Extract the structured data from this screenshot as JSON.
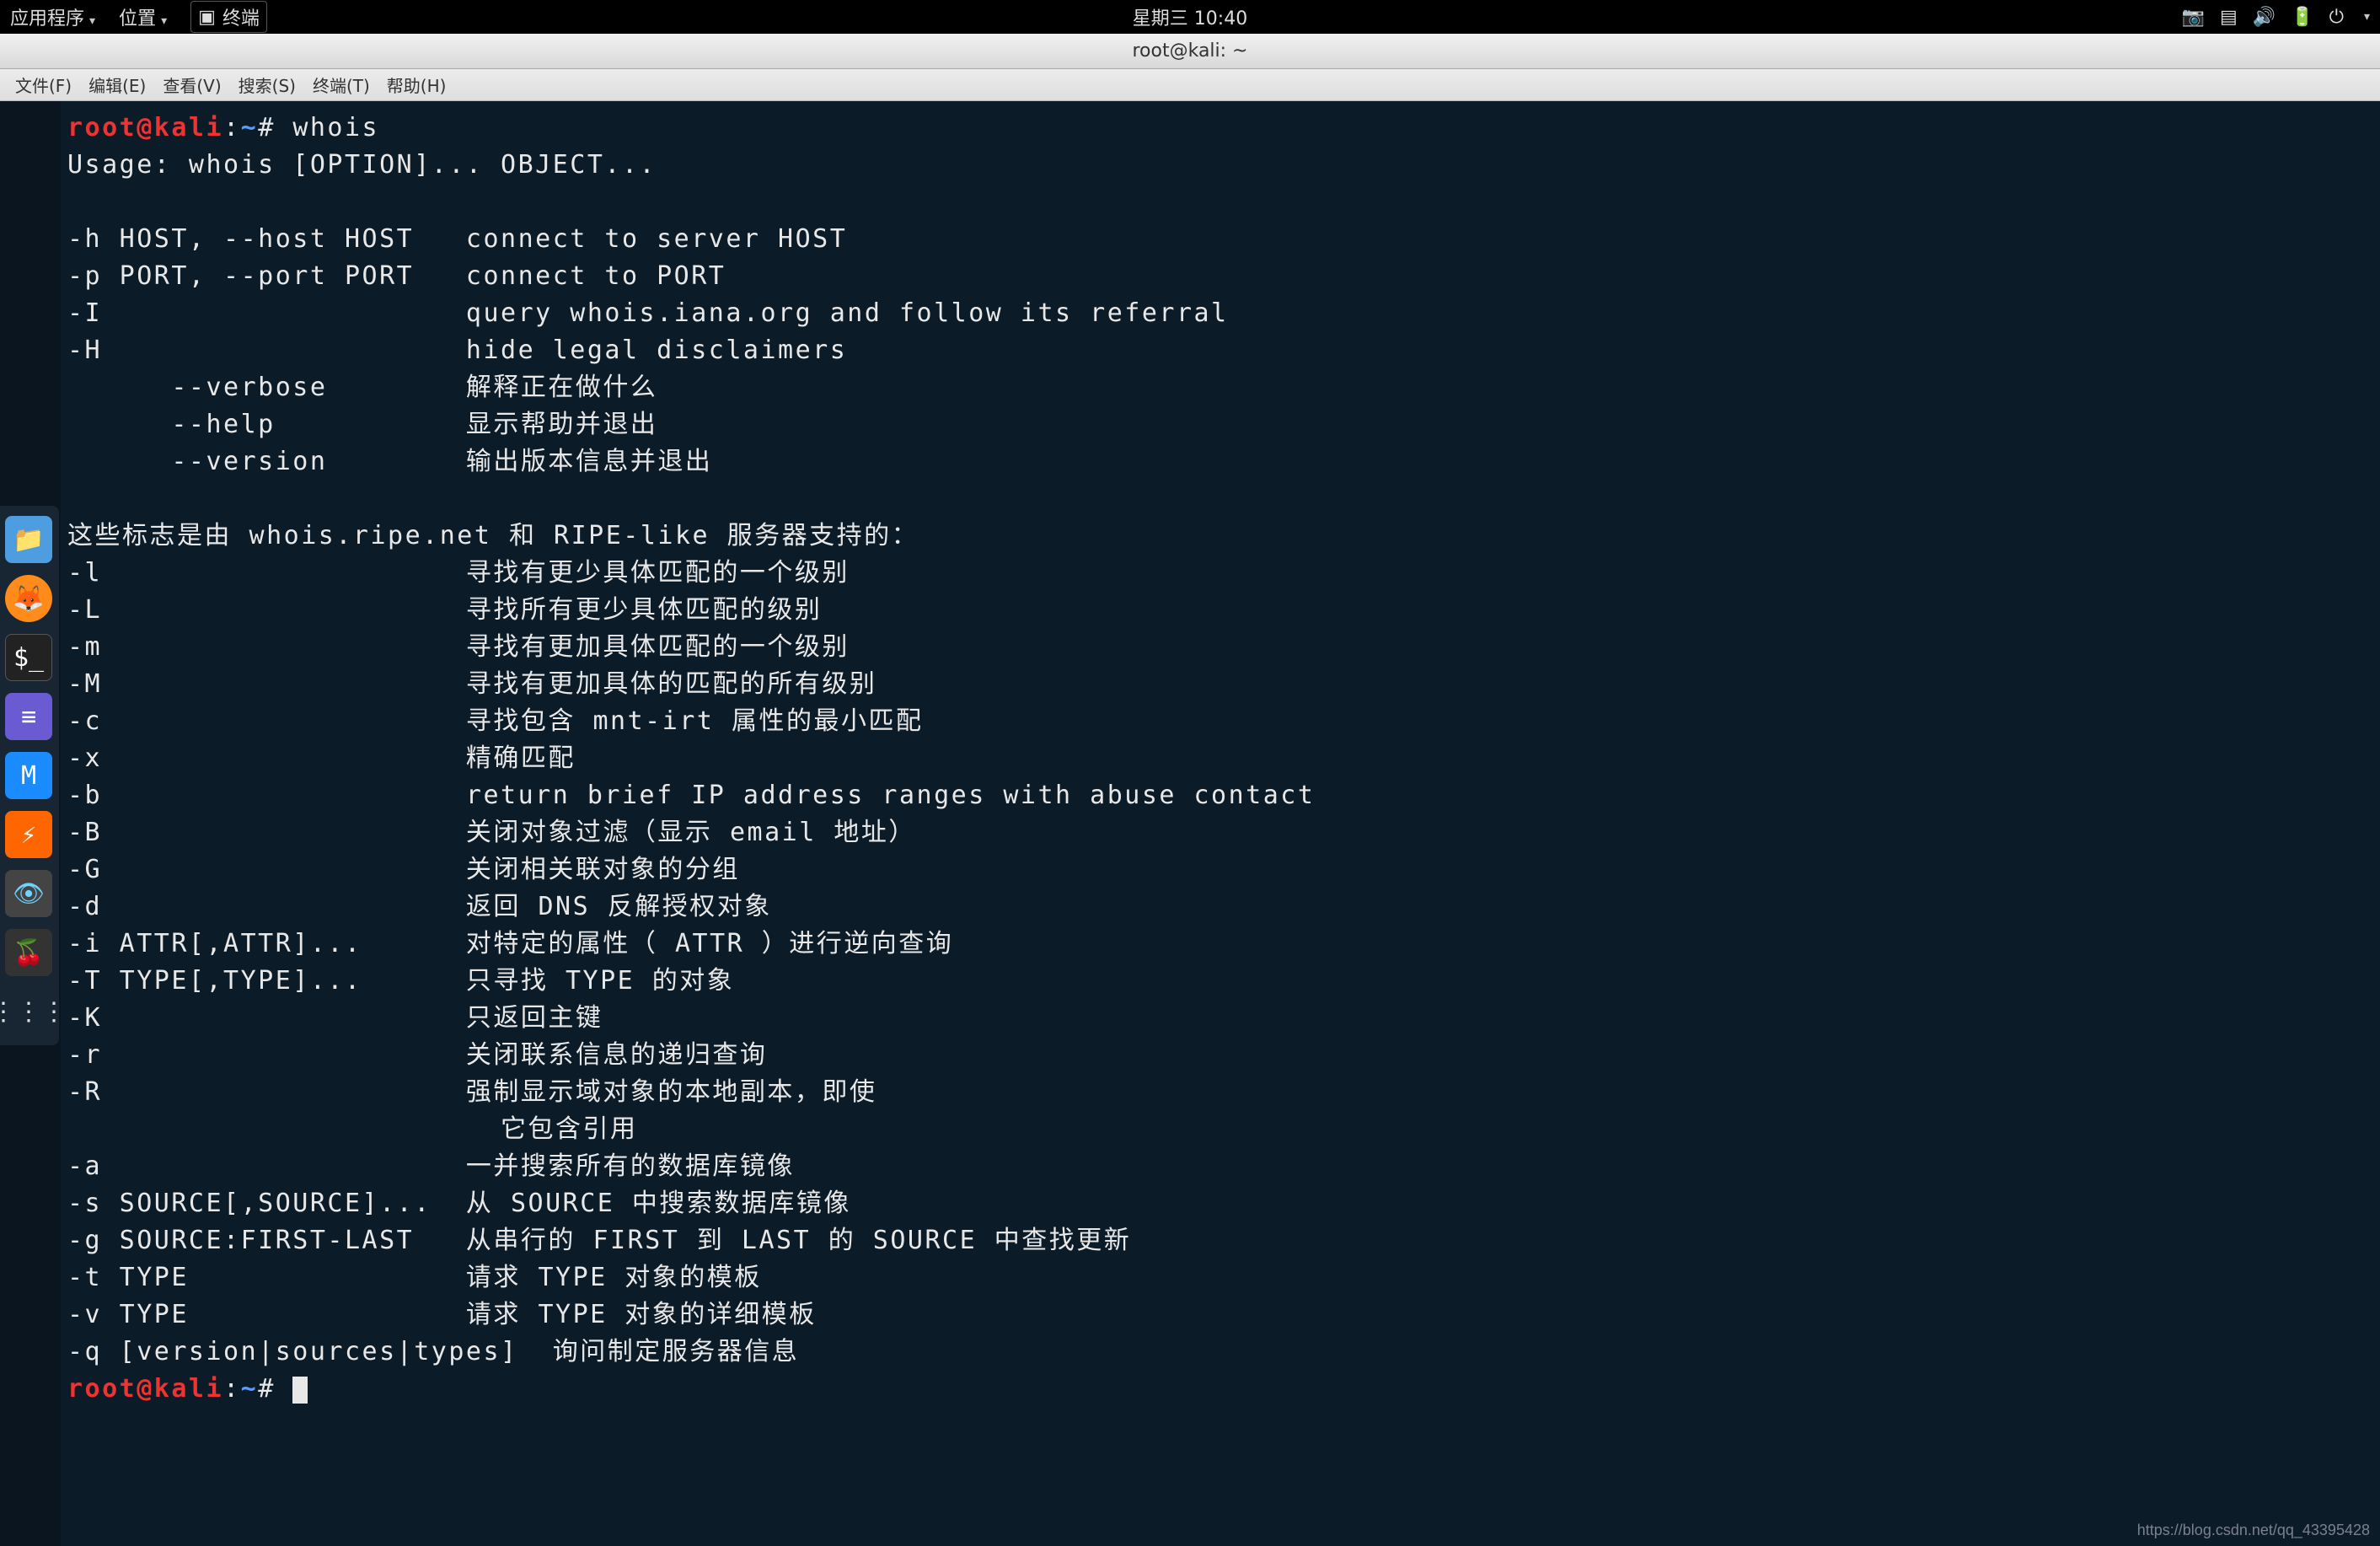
{
  "top_panel": {
    "apps": "应用程序",
    "places": "位置",
    "terminal_btn": "终端",
    "clock": "星期三 10:40"
  },
  "window": {
    "title": "root@kali: ~"
  },
  "menu": {
    "file": "文件(F)",
    "edit": "编辑(E)",
    "view": "查看(V)",
    "search": "搜索(S)",
    "terminal": "终端(T)",
    "help": "帮助(H)"
  },
  "dock": {
    "files": "files-app",
    "firefox": "firefox-app",
    "terminal": "terminal-app",
    "texteditor": "text-editor-app",
    "metasploit": "metasploit-app",
    "zenmap": "zenmap-app",
    "eye": "eye-app",
    "cherry": "cherrytree-app",
    "grid": "show-apps"
  },
  "prompt": {
    "user": "root@kali",
    "path": "~",
    "symbol": "#"
  },
  "command": "whois",
  "output": [
    "Usage: whois [OPTION]... OBJECT...",
    "",
    "-h HOST, --host HOST   connect to server HOST",
    "-p PORT, --port PORT   connect to PORT",
    "-I                     query whois.iana.org and follow its referral",
    "-H                     hide legal disclaimers",
    "      --verbose        解释正在做什么",
    "      --help           显示帮助并退出",
    "      --version        输出版本信息并退出",
    "",
    "这些标志是由 whois.ripe.net 和 RIPE-like 服务器支持的：",
    "-l                     寻找有更少具体匹配的一个级别",
    "-L                     寻找所有更少具体匹配的级别",
    "-m                     寻找有更加具体匹配的一个级别",
    "-M                     寻找有更加具体的匹配的所有级别",
    "-c                     寻找包含 mnt-irt 属性的最小匹配",
    "-x                     精确匹配",
    "-b                     return brief IP address ranges with abuse contact",
    "-B                     关闭对象过滤（显示 email 地址）",
    "-G                     关闭相关联对象的分组",
    "-d                     返回 DNS 反解授权对象",
    "-i ATTR[,ATTR]...      对特定的属性（ ATTR ）进行逆向查询",
    "-T TYPE[,TYPE]...      只寻找 TYPE 的对象",
    "-K                     只返回主键",
    "-r                     关闭联系信息的递归查询",
    "-R                     强制显示域对象的本地副本，即使",
    "                         它包含引用",
    "-a                     一并搜索所有的数据库镜像",
    "-s SOURCE[,SOURCE]...  从 SOURCE 中搜索数据库镜像",
    "-g SOURCE:FIRST-LAST   从串行的 FIRST 到 LAST 的 SOURCE 中查找更新",
    "-t TYPE                请求 TYPE 对象的模板",
    "-v TYPE                请求 TYPE 对象的详细模板",
    "-q [version|sources|types]  询问制定服务器信息"
  ],
  "watermark": "https://blog.csdn.net/qq_43395428"
}
